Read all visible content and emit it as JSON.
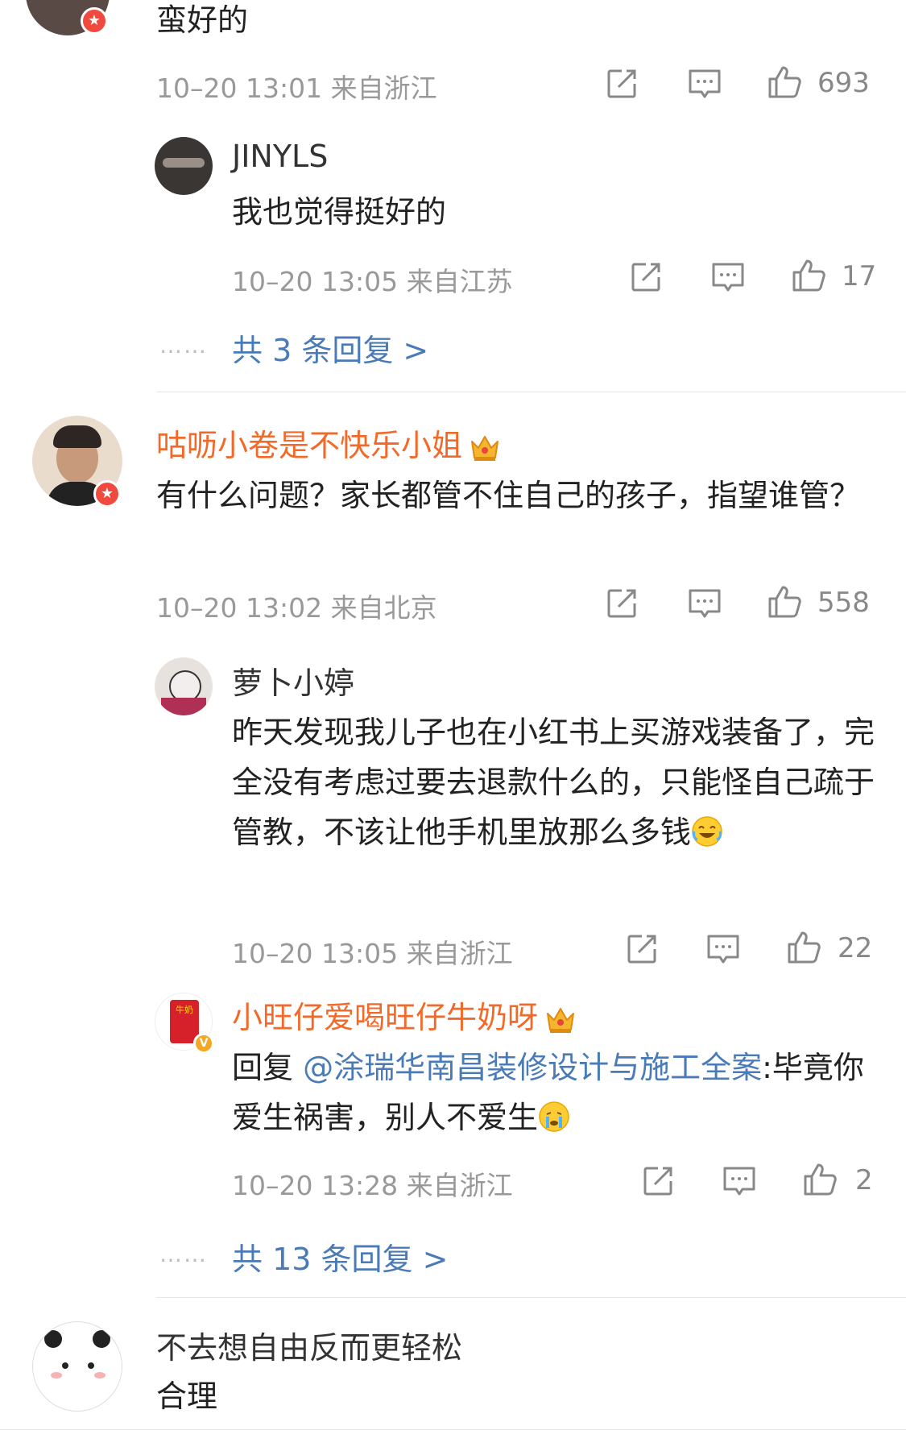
{
  "comment1": {
    "text": "蛮好的",
    "meta": "10–20 13:01  来自浙江",
    "likes": "693"
  },
  "reply1": {
    "name": "JINYLS",
    "text": "我也觉得挺好的",
    "meta": "10–20 13:05  来自江苏",
    "likes": "17"
  },
  "more1": {
    "label": "共 3 条回复 >"
  },
  "comment2": {
    "name": "咕呖小卷是不快乐小姐",
    "text": "有什么问题？家长都管不住自己的孩子，指望谁管？",
    "meta": "10–20 13:02  来自北京",
    "likes": "558"
  },
  "reply2": {
    "name": "萝卜小婷",
    "text": "昨天发现我儿子也在小红书上买游戏装备了，完全没有考虑过要去退款什么的，只能怪自己疏于管教，不该让他手机里放那么多钱",
    "meta": "10–20 13:05  来自浙江",
    "likes": "22"
  },
  "reply3": {
    "name": "小旺仔爱喝旺仔牛奶呀",
    "reply_prefix": "回复 ",
    "mention": "@涂瑞华南昌装修设计与施工全案",
    "text": ":毕竟你爱生祸害，别人不爱生",
    "meta": "10–20 13:28  来自浙江",
    "likes": "2",
    "avatar_text": "牛奶"
  },
  "more2": {
    "label": "共 13 条回复 >"
  },
  "comment3": {
    "name": "不去想自由反而更轻松",
    "text": "合理"
  },
  "colors": {
    "accent": "#f26a2a",
    "link": "#4a7bb7",
    "meta": "#999999"
  },
  "icons": [
    "forward-icon",
    "comment-icon",
    "like-icon",
    "crown-icon",
    "laugh-emoji",
    "cry-emoji"
  ]
}
